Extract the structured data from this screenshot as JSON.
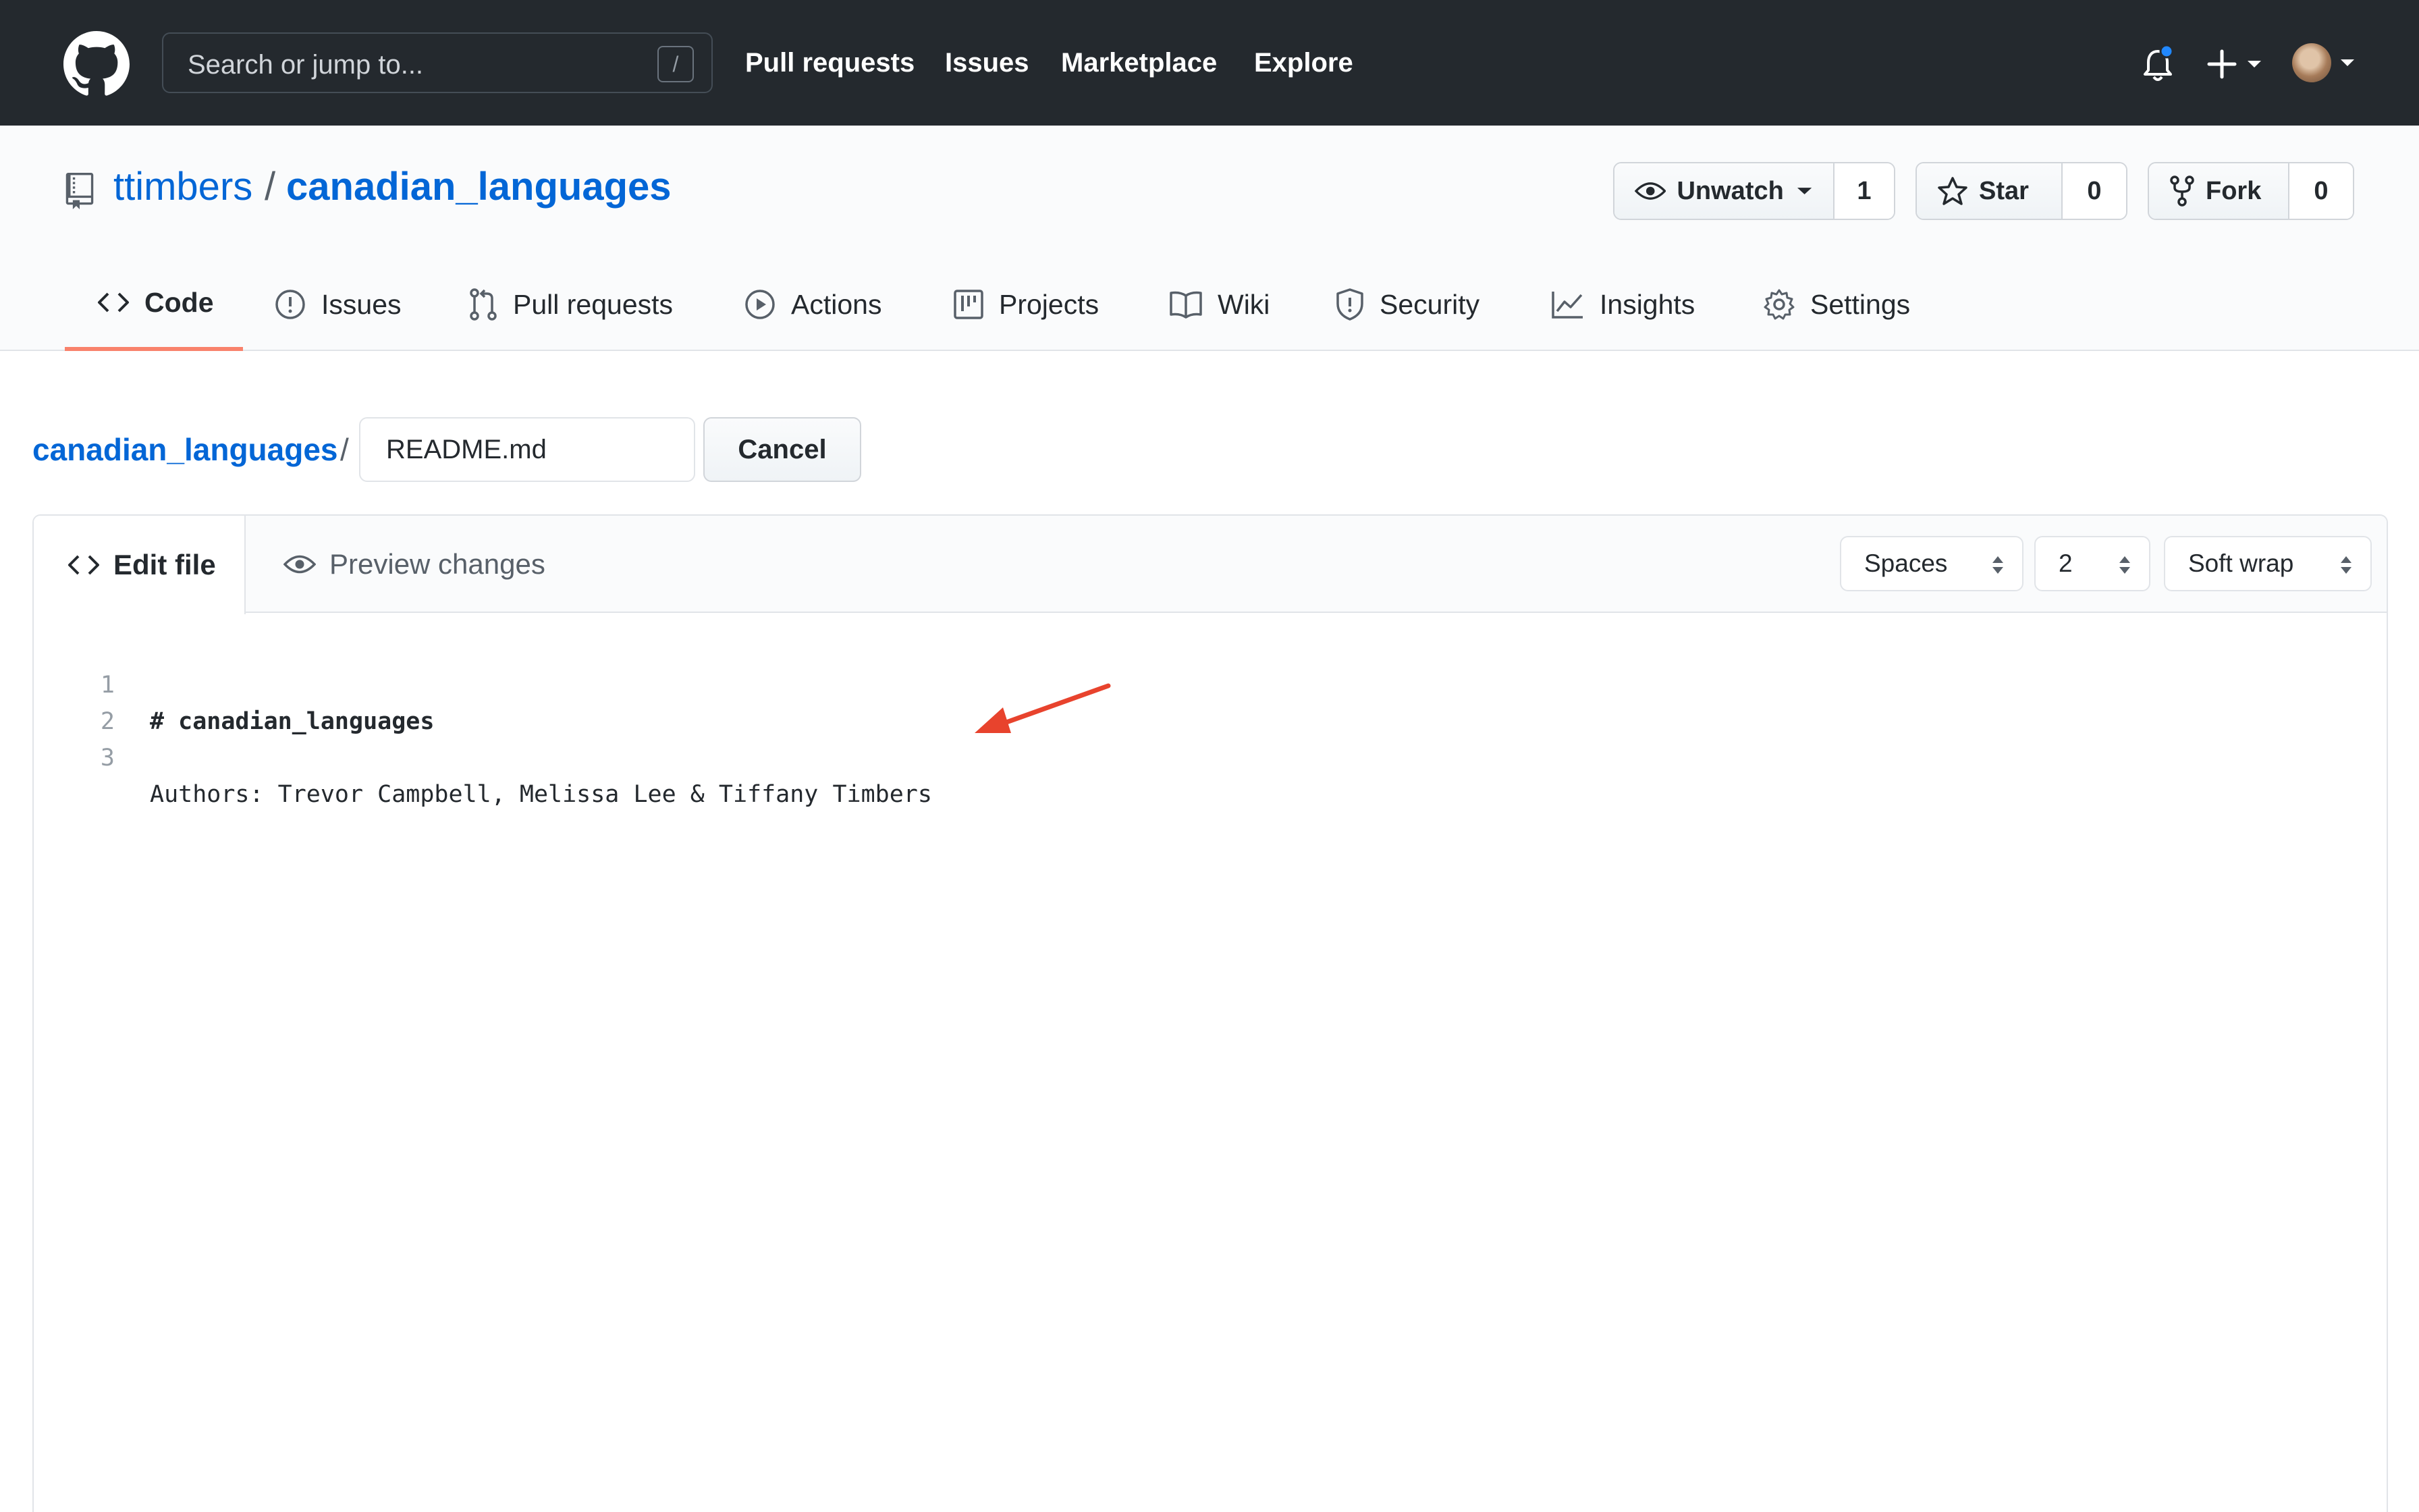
{
  "header": {
    "search_placeholder": "Search or jump to...",
    "slash_hint": "/",
    "nav": [
      "Pull requests",
      "Issues",
      "Marketplace",
      "Explore"
    ],
    "notification_dot_color": "#2188ff",
    "bg_color": "#24292e"
  },
  "repo": {
    "owner": "ttimbers",
    "separator": "/",
    "name": "canadian_languages",
    "watch": {
      "label": "Unwatch",
      "count": "1"
    },
    "star": {
      "label": "Star",
      "count": "0"
    },
    "fork": {
      "label": "Fork",
      "count": "0"
    }
  },
  "tabs": [
    {
      "label": "Code",
      "icon": "code-icon",
      "selected": true
    },
    {
      "label": "Issues",
      "icon": "issue-icon"
    },
    {
      "label": "Pull requests",
      "icon": "pull-request-icon"
    },
    {
      "label": "Actions",
      "icon": "play-icon"
    },
    {
      "label": "Projects",
      "icon": "project-icon"
    },
    {
      "label": "Wiki",
      "icon": "book-icon"
    },
    {
      "label": "Security",
      "icon": "shield-icon"
    },
    {
      "label": "Insights",
      "icon": "graph-icon"
    },
    {
      "label": "Settings",
      "icon": "gear-icon"
    }
  ],
  "editbar": {
    "root_link": "canadian_languages",
    "separator": "/",
    "filename": "README.md",
    "cancel_label": "Cancel"
  },
  "editor": {
    "edit_tab_label": "Edit file",
    "preview_tab_label": "Preview changes",
    "indent_mode": "Spaces",
    "indent_size": "2",
    "wrap_mode": "Soft wrap",
    "lines": [
      {
        "num": "1",
        "text": "# canadian_languages"
      },
      {
        "num": "2",
        "text": ""
      },
      {
        "num": "3",
        "text": "Authors: Trevor Campbell, Melissa Lee & Tiffany Timbers"
      }
    ]
  },
  "annotation": {
    "arrow_color": "#e8432d"
  },
  "colors": {
    "link": "#0366d6",
    "tab_underline": "#f9826c"
  }
}
